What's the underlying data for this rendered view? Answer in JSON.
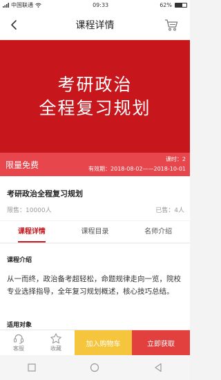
{
  "status_bar": {
    "carrier": "中国联通",
    "time": "09:33",
    "battery": "62%",
    "battery_level": 0.62
  },
  "nav": {
    "title": "课程详情",
    "back_icon": "chevron-left-icon",
    "cart_icon": "cart-icon"
  },
  "banner": {
    "line1": "考研政治",
    "line2": "全程复习规划",
    "background": "#c8161d"
  },
  "promo": {
    "label": "限量免费",
    "hours": "课时：2",
    "validity": "有效期：2018-08-02——2018-10-01"
  },
  "course": {
    "title": "考研政治全程复习规划",
    "limit": "限售：10000人",
    "sold": "已售：4人"
  },
  "tabs": [
    {
      "label": "课程详情",
      "active": true
    },
    {
      "label": "课程目录",
      "active": false
    },
    {
      "label": "名师介绍",
      "active": false
    }
  ],
  "content": {
    "section_title": "课程介绍",
    "intro": "从一而终，政治备考超轻松，命题规律走向一览，院校专业选择指导，全年复习规划概述，核心技巧总结。",
    "audience_title": "适用对象"
  },
  "actions": {
    "service_label": "客服",
    "favorite_label": "收藏",
    "add_cart_label": "加入购物车",
    "buy_label": "立即获取"
  },
  "colors": {
    "primary": "#c8161d",
    "promo": "#e7464d",
    "add_cart": "#f5c63d",
    "buy": "#e2403f"
  }
}
